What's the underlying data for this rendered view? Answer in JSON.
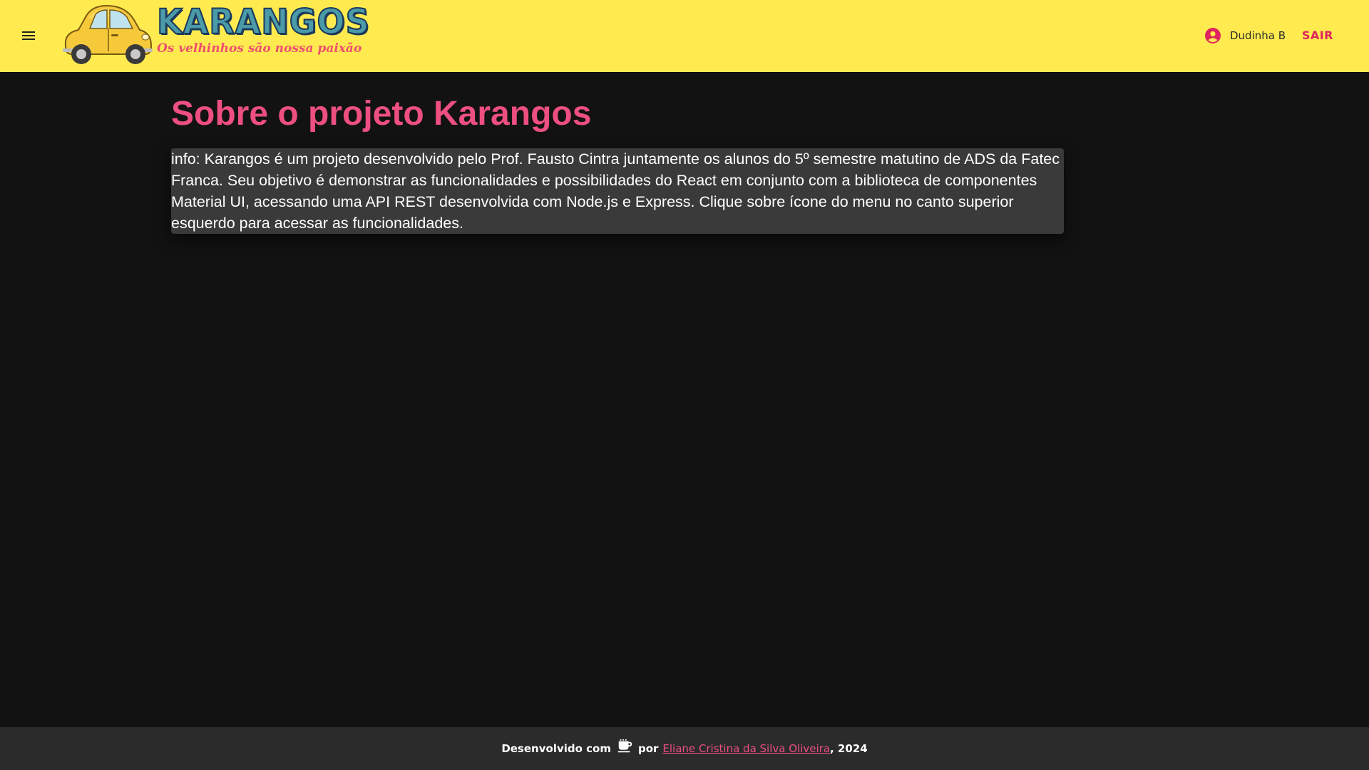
{
  "header": {
    "logo": {
      "title": "KARANGOS",
      "tagline": "Os velhinhos são nossa paixão"
    },
    "user": {
      "name": "Dudinha B"
    },
    "logout_label": "SAIR"
  },
  "main": {
    "title": "Sobre o projeto Karangos",
    "info_text": "info: Karangos é um projeto desenvolvido pelo Prof. Fausto Cintra juntamente os alunos do 5º semestre matutino de ADS da Fatec Franca. Seu objetivo é demonstrar as funcionalidades e possibilidades do React em conjunto com a biblioteca de componentes Material UI, acessando uma API REST desenvolvida com Node.js e Express. Clique sobre ícone do menu no canto superior esquerdo para acessar as funcionalidades."
  },
  "footer": {
    "prefix": "Desenvolvido com",
    "middle": "por",
    "author": "Eliane Cristina da Silva Oliveira",
    "suffix": ", 2024"
  },
  "colors": {
    "appbar": "#ffeb4f",
    "accent": "#ec4f80",
    "logout": "#e0245e",
    "background": "#121212",
    "info_box": "#3a3a3a",
    "footer": "#2b2b2b"
  },
  "icons": {
    "menu": "menu-icon",
    "user": "account-circle-icon",
    "coffee": "coffee-icon",
    "logo_car": "car-icon"
  }
}
